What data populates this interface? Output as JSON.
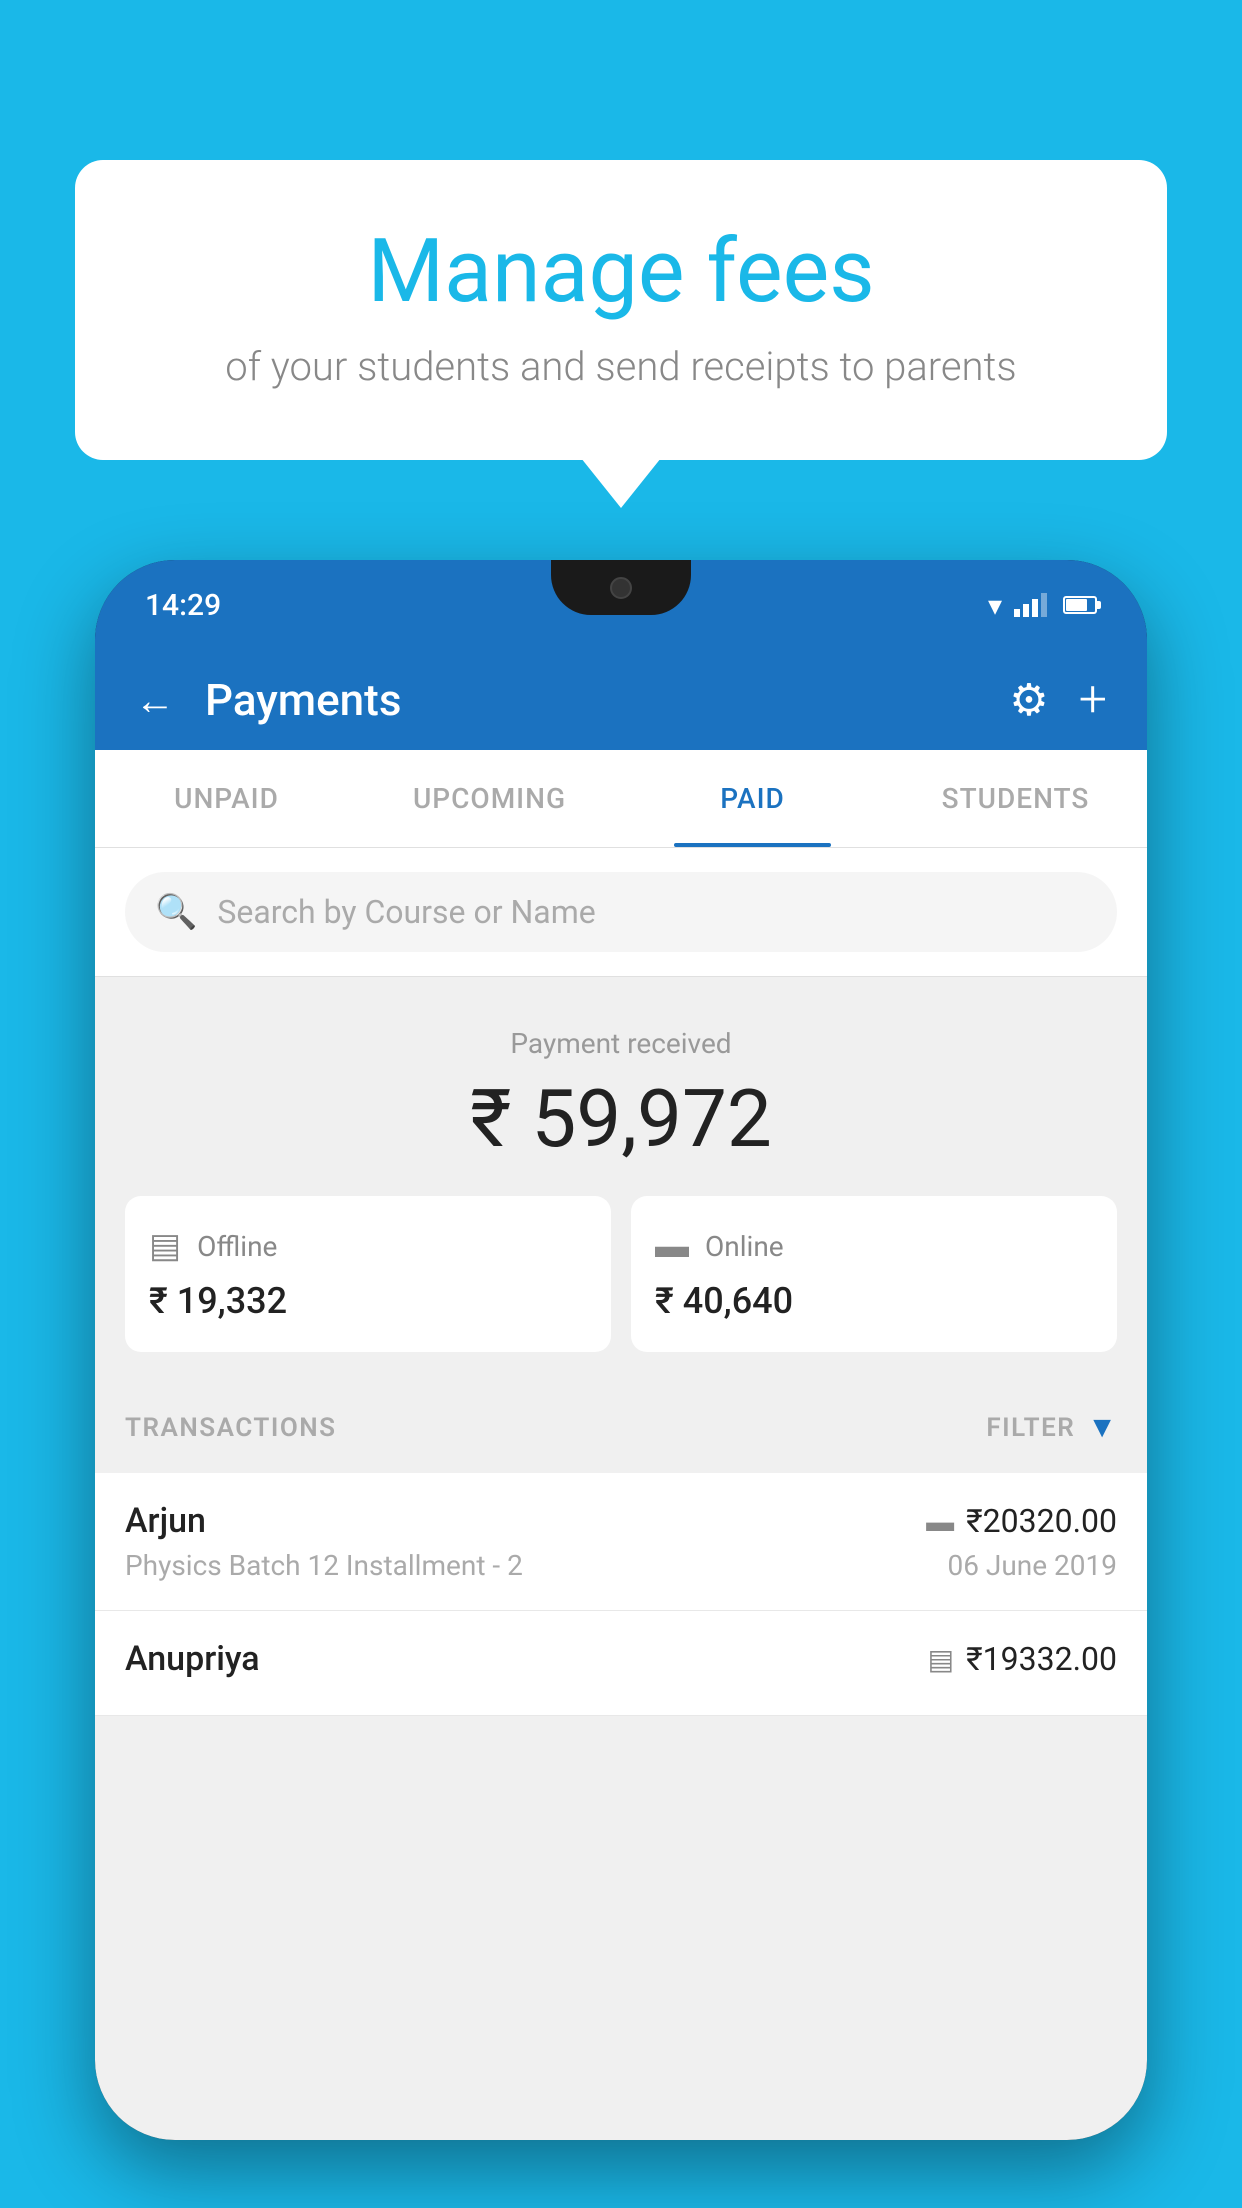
{
  "background_color": "#1ab8e8",
  "speech_bubble": {
    "headline": "Manage fees",
    "subtext": "of your students and send receipts to parents"
  },
  "phone": {
    "status_bar": {
      "time": "14:29"
    },
    "header": {
      "title": "Payments",
      "back_label": "←",
      "gear_label": "⚙",
      "plus_label": "+"
    },
    "tabs": [
      {
        "label": "UNPAID",
        "active": false
      },
      {
        "label": "UPCOMING",
        "active": false
      },
      {
        "label": "PAID",
        "active": true
      },
      {
        "label": "STUDENTS",
        "active": false
      }
    ],
    "search": {
      "placeholder": "Search by Course or Name"
    },
    "payment_summary": {
      "label": "Payment received",
      "amount": "₹ 59,972",
      "offline": {
        "label": "Offline",
        "amount": "₹ 19,332"
      },
      "online": {
        "label": "Online",
        "amount": "₹ 40,640"
      }
    },
    "transactions": {
      "header_label": "TRANSACTIONS",
      "filter_label": "FILTER",
      "rows": [
        {
          "name": "Arjun",
          "course": "Physics Batch 12 Installment - 2",
          "amount": "₹20320.00",
          "date": "06 June 2019",
          "payment_type": "online"
        },
        {
          "name": "Anupriya",
          "course": "",
          "amount": "₹19332.00",
          "date": "",
          "payment_type": "offline"
        }
      ]
    }
  }
}
